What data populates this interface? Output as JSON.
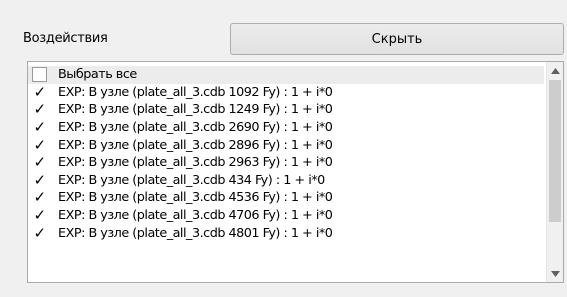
{
  "header": {
    "label": "Воздействия",
    "hide_button_label": "Скрыть"
  },
  "list": {
    "select_all": {
      "label": "Выбрать все",
      "checked": false
    },
    "items": [
      {
        "label": "EXP: В узле (plate_all_3.cdb 1092 Fy) : 1 + i*0",
        "checked": true
      },
      {
        "label": "EXP: В узле (plate_all_3.cdb 1249 Fy) : 1 + i*0",
        "checked": true
      },
      {
        "label": "EXP: В узле (plate_all_3.cdb 2690 Fy) : 1 + i*0",
        "checked": true
      },
      {
        "label": "EXP: В узле (plate_all_3.cdb 2896 Fy) : 1 + i*0",
        "checked": true
      },
      {
        "label": "EXP: В узле (plate_all_3.cdb 2963 Fy) : 1 + i*0",
        "checked": true
      },
      {
        "label": "EXP: В узле (plate_all_3.cdb 434 Fy) : 1 + i*0",
        "checked": true
      },
      {
        "label": "EXP: В узле (plate_all_3.cdb 4536 Fy) : 1 + i*0",
        "checked": true
      },
      {
        "label": "EXP: В узле (plate_all_3.cdb 4706 Fy) : 1 + i*0",
        "checked": true
      },
      {
        "label": "EXP: В узле (plate_all_3.cdb 4801 Fy) : 1 + i*0",
        "checked": true
      }
    ],
    "check_glyph": "✓"
  },
  "icons": {
    "scroll_up": "scroll-up-arrow-icon",
    "scroll_down": "scroll-down-arrow-icon"
  }
}
